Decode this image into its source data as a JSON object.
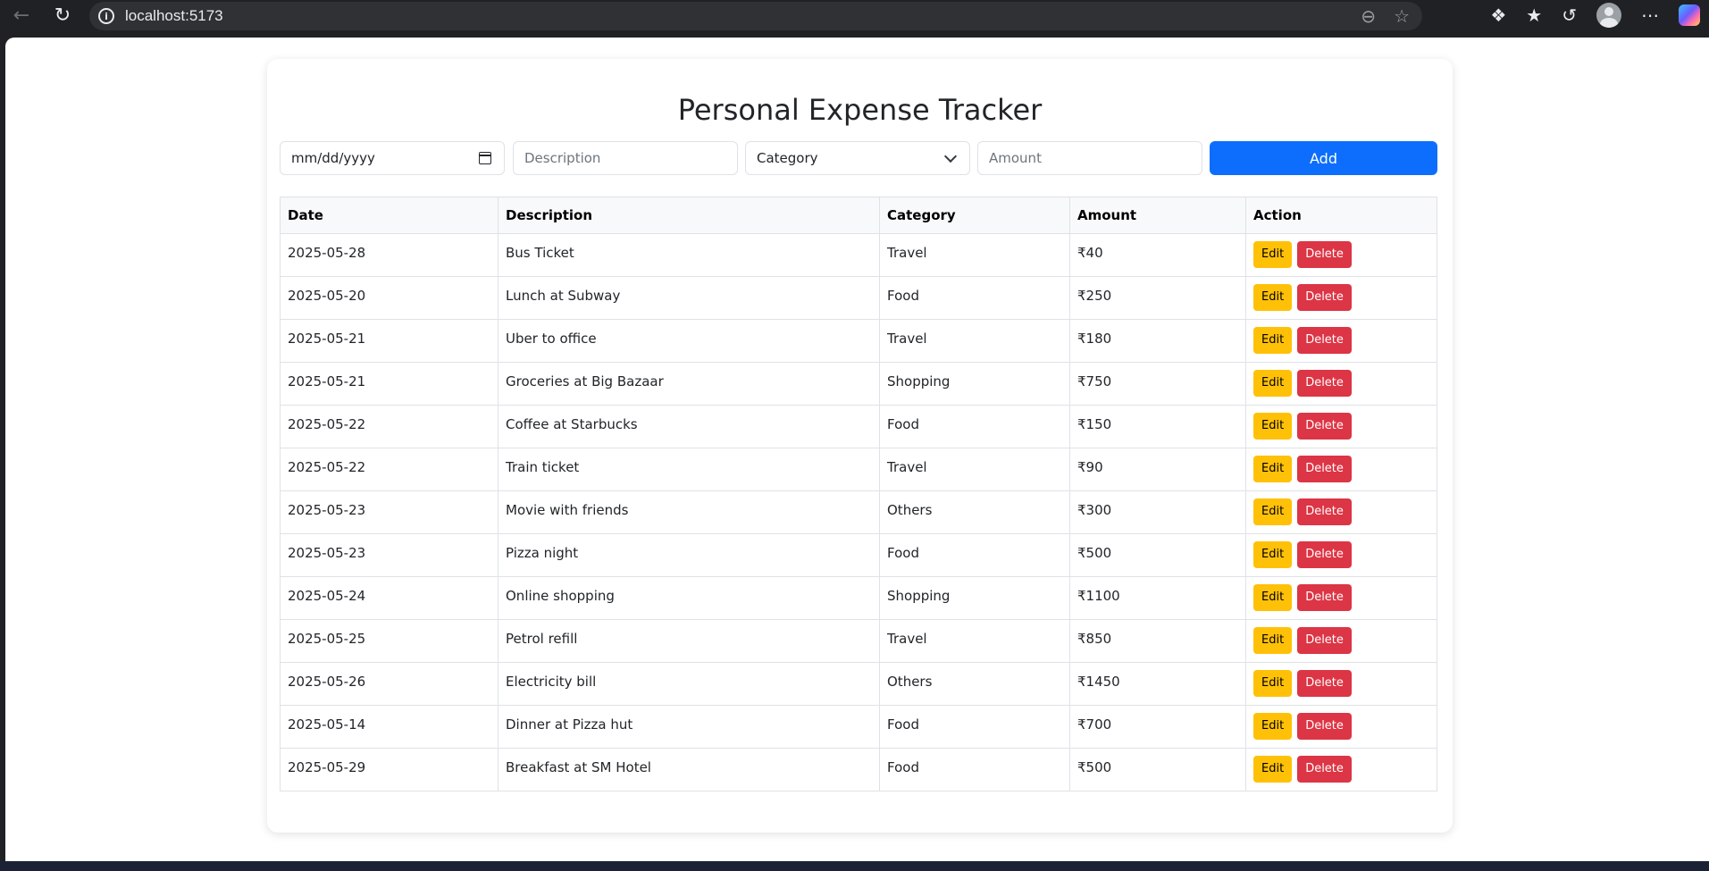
{
  "browser": {
    "url": "localhost:5173"
  },
  "app": {
    "title": "Personal Expense Tracker"
  },
  "form": {
    "date_placeholder": "mm/dd/yyyy",
    "description_placeholder": "Description",
    "category_selected": "Category",
    "amount_placeholder": "Amount",
    "add_label": "Add"
  },
  "table": {
    "headers": {
      "date": "Date",
      "description": "Description",
      "category": "Category",
      "amount": "Amount",
      "action": "Action"
    },
    "rows": [
      {
        "date": "2025-05-28",
        "description": "Bus Ticket",
        "category": "Travel",
        "amount": "₹40"
      },
      {
        "date": "2025-05-20",
        "description": "Lunch at Subway",
        "category": "Food",
        "amount": "₹250"
      },
      {
        "date": "2025-05-21",
        "description": "Uber to office",
        "category": "Travel",
        "amount": "₹180"
      },
      {
        "date": "2025-05-21",
        "description": "Groceries at Big Bazaar",
        "category": "Shopping",
        "amount": "₹750"
      },
      {
        "date": "2025-05-22",
        "description": "Coffee at Starbucks",
        "category": "Food",
        "amount": "₹150"
      },
      {
        "date": "2025-05-22",
        "description": "Train ticket",
        "category": "Travel",
        "amount": "₹90"
      },
      {
        "date": "2025-05-23",
        "description": "Movie with friends",
        "category": "Others",
        "amount": "₹300"
      },
      {
        "date": "2025-05-23",
        "description": "Pizza night",
        "category": "Food",
        "amount": "₹500"
      },
      {
        "date": "2025-05-24",
        "description": "Online shopping",
        "category": "Shopping",
        "amount": "₹1100"
      },
      {
        "date": "2025-05-25",
        "description": "Petrol refill",
        "category": "Travel",
        "amount": "₹850"
      },
      {
        "date": "2025-05-26",
        "description": "Electricity bill",
        "category": "Others",
        "amount": "₹1450"
      },
      {
        "date": "2025-05-14",
        "description": "Dinner at Pizza hut",
        "category": "Food",
        "amount": "₹700"
      },
      {
        "date": "2025-05-29",
        "description": "Breakfast at SM Hotel",
        "category": "Food",
        "amount": "₹500"
      }
    ],
    "edit_label": "Edit",
    "delete_label": "Delete"
  },
  "colors": {
    "primary": "#0d6efd",
    "warning": "#ffc107",
    "danger": "#dc3545"
  }
}
